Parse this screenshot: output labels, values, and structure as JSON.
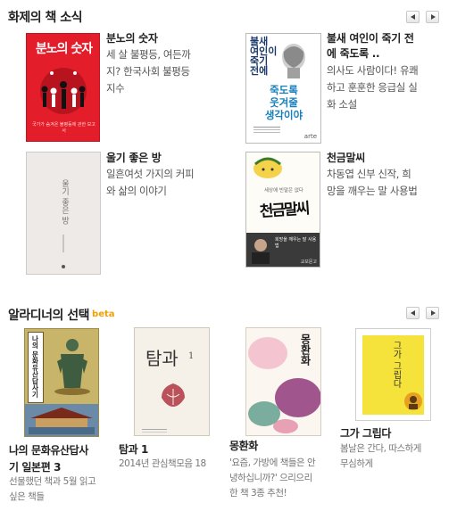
{
  "section1": {
    "title": "화제의 책 소식",
    "books": [
      {
        "title": "분노의 숫자",
        "desc_lines": [
          "세 살 불평등, 여든까",
          "지? 한국사회 불평등",
          "지수"
        ],
        "cover": {
          "bg": "#e31d2a",
          "title": "분노의 숫자",
          "footer": "국가가 숨겨온 불평등에 관한 보고서"
        }
      },
      {
        "title_lines": [
          "불새 여인이 죽기 전",
          "에 죽도록 .."
        ],
        "desc_lines": [
          "의사도 사람이다! 유쾌",
          "하고 훈훈한 응급실 실",
          "화 소설"
        ],
        "cover": {
          "title_lines": [
            "불새",
            "여인이",
            "죽기",
            "전에"
          ],
          "sub_lines": [
            "죽도록",
            "웃겨줄",
            "생각이야"
          ],
          "publisher": "arte"
        }
      },
      {
        "title": "울기 좋은 방",
        "desc_lines": [
          "일흔여섯 가지의 커피",
          "와 삶의 이야기"
        ],
        "cover": {
          "vtitle": "울기 좋은 방"
        }
      },
      {
        "title": "천금말씨",
        "desc_lines": [
          "차동엽 신부 신작, 희",
          "망을 깨우는 말 사용법"
        ],
        "cover": {
          "top": "세상에 빈말은 없다",
          "calligraphy": "천금말씨",
          "tag": "희망을 깨우는 말 사용법",
          "publisher": "교보문고"
        }
      }
    ]
  },
  "section2": {
    "title": "알라디너의 선택",
    "badge": "beta",
    "books": [
      {
        "title_lines": [
          "나의 문화유산답사",
          "기 일본편 3"
        ],
        "desc_lines": [
          "선물했던 책과 5월 읽고",
          "싶은 책들"
        ],
        "cover": {
          "vtitle": "나의 문화유산답사기"
        }
      },
      {
        "title": "탐과 1",
        "desc_lines": [
          "2014년 관심책모음 18"
        ],
        "cover": {
          "title": "탐과",
          "num": "1"
        }
      },
      {
        "title": "몽환화",
        "desc_lines": [
          "'요즘, 가방에 책들은 안",
          "녕하십니까?' 으리으리",
          "한 책 3종 추천!"
        ],
        "cover": {
          "vtitle": "몽환화"
        }
      },
      {
        "title": "그가 그립다",
        "desc_lines": [
          "봄날은 간다, 따스하게",
          "무심하게"
        ],
        "cover": {
          "vtitle": "그가 그립다"
        }
      }
    ]
  },
  "colors": {
    "badge": "#f0a000",
    "title_text": "#222222",
    "desc_text": "#555555"
  }
}
